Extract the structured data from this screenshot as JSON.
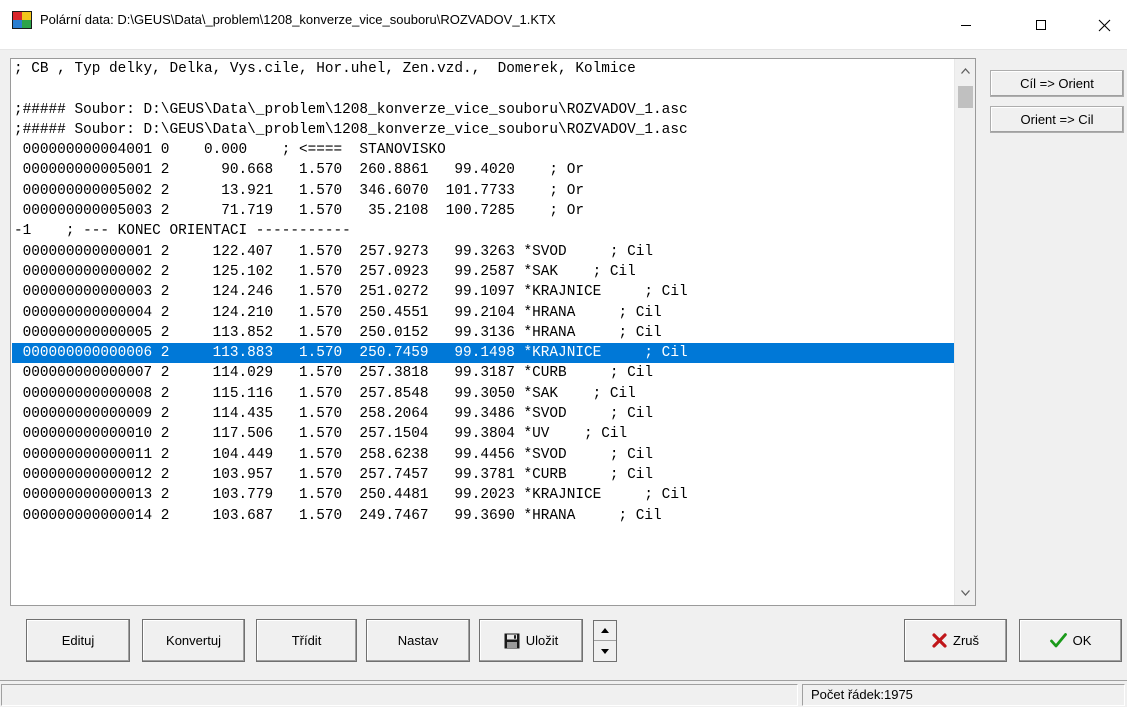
{
  "window": {
    "title": "Polární data: D:\\GEUS\\Data\\_problem\\1208_konverze_vice_souboru\\ROZVADOV_1.KTX",
    "icon": "app-globe-icon"
  },
  "editor": {
    "selected_index": 14,
    "lines": [
      "; CB , Typ delky, Delka, Vys.cile, Hor.uhel, Zen.vzd.,  Domerek, Kolmice",
      "",
      ";##### Soubor: D:\\GEUS\\Data\\_problem\\1208_konverze_vice_souboru\\ROZVADOV_1.asc",
      ";##### Soubor: D:\\GEUS\\Data\\_problem\\1208_konverze_vice_souboru\\ROZVADOV_1.asc",
      " 000000000004001 0    0.000    ; <====  STANOVISKO",
      " 000000000005001 2      90.668   1.570  260.8861   99.4020    ; Or",
      " 000000000005002 2      13.921   1.570  346.6070  101.7733    ; Or",
      " 000000000005003 2      71.719   1.570   35.2108  100.7285    ; Or",
      "-1    ; --- KONEC ORIENTACI -----------",
      " 000000000000001 2     122.407   1.570  257.9273   99.3263 *SVOD     ; Cil",
      " 000000000000002 2     125.102   1.570  257.0923   99.2587 *SAK    ; Cil",
      " 000000000000003 2     124.246   1.570  251.0272   99.1097 *KRAJNICE     ; Cil",
      " 000000000000004 2     124.210   1.570  250.4551   99.2104 *HRANA     ; Cil",
      " 000000000000005 2     113.852   1.570  250.0152   99.3136 *HRANA     ; Cil",
      " 000000000000006 2     113.883   1.570  250.7459   99.1498 *KRAJNICE     ; Cil",
      " 000000000000007 2     114.029   1.570  257.3818   99.3187 *CURB     ; Cil",
      " 000000000000008 2     115.116   1.570  257.8548   99.3050 *SAK    ; Cil",
      " 000000000000009 2     114.435   1.570  258.2064   99.3486 *SVOD     ; Cil",
      " 000000000000010 2     117.506   1.570  257.1504   99.3804 *UV    ; Cil",
      " 000000000000011 2     104.449   1.570  258.6238   99.4456 *SVOD     ; Cil",
      " 000000000000012 2     103.957   1.570  257.7457   99.3781 *CURB     ; Cil",
      " 000000000000013 2     103.779   1.570  250.4481   99.2023 *KRAJNICE     ; Cil",
      " 000000000000014 2     103.687   1.570  249.7467   99.3690 *HRANA     ; Cil"
    ]
  },
  "side_buttons": {
    "cil_orient": "Cíl => Orient",
    "orient_cil": "Orient => Cil"
  },
  "buttons": {
    "edituj": "Edituj",
    "konvertuj": "Konvertuj",
    "tridit": "Třídit",
    "nastav": "Nastav",
    "ulozit": "Uložit",
    "zrus": "Zruš",
    "ok": "OK"
  },
  "status": {
    "pane1": "",
    "row_count": "Počet řádek:1975"
  },
  "colors": {
    "selection": "#0078d7",
    "cancel_x": "#c0161a",
    "ok_check": "#1a9a1a"
  }
}
